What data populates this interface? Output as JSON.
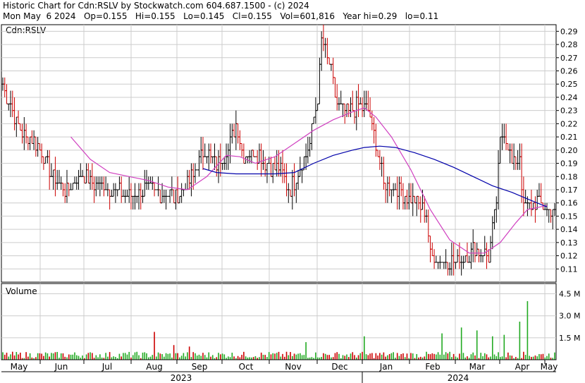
{
  "header": {
    "title": "Historic Chart for Cdn:RSLV by Stockwatch.com 604.687.1500 - (c) 2024",
    "stats": "Mon May  6 2024   Op=0.155   Hi=0.155   Lo=0.145   Cl=0.155   Vol=601,816   Year hi=0.29   lo=0.11"
  },
  "colors": {
    "up": "#000000",
    "down": "#cc0000",
    "ma_short": "#d040c0",
    "ma_long": "#0000aa",
    "vol_up": "#22aa22",
    "vol_down": "#cc0000",
    "grid": "#cccccc"
  },
  "chart_data": {
    "type": "ohlc",
    "symbol_label": "Cdn:RSLV",
    "y_ticks": [
      "0.29",
      "0.28",
      "0.27",
      "0.26",
      "0.25",
      "0.24",
      "0.23",
      "0.22",
      "0.21",
      "0.20",
      "0.19",
      "0.18",
      "0.17",
      "0.16",
      "0.15",
      "0.14",
      "0.13",
      "0.12",
      "0.11"
    ],
    "ylim": [
      0.1,
      0.295
    ],
    "x_months": [
      "May",
      "Jun",
      "Jul",
      "Aug",
      "Sep",
      "Oct",
      "Nov",
      "Dec",
      "Jan",
      "Feb",
      "Mar",
      "Apr",
      "May"
    ],
    "year_labels": [
      "2023",
      "2024"
    ],
    "volume_label": "Volume",
    "volume_ticks": [
      "4.5 M",
      "3.0 M",
      "1.5 M"
    ],
    "volume_ylim": [
      0,
      5.2
    ],
    "price_segments": [
      [
        0,
        0.25
      ],
      [
        6,
        0.225
      ],
      [
        12,
        0.21
      ],
      [
        18,
        0.205
      ],
      [
        24,
        0.185
      ],
      [
        32,
        0.17
      ],
      [
        40,
        0.18
      ],
      [
        48,
        0.175
      ],
      [
        56,
        0.172
      ],
      [
        64,
        0.165
      ],
      [
        72,
        0.17
      ],
      [
        80,
        0.168
      ],
      [
        88,
        0.165
      ],
      [
        96,
        0.175
      ],
      [
        104,
        0.2
      ],
      [
        110,
        0.19
      ],
      [
        116,
        0.2
      ],
      [
        120,
        0.22
      ],
      [
        124,
        0.195
      ],
      [
        130,
        0.2
      ],
      [
        136,
        0.19
      ],
      [
        142,
        0.185
      ],
      [
        148,
        0.17
      ],
      [
        154,
        0.19
      ],
      [
        158,
        0.205
      ],
      [
        162,
        0.24
      ],
      [
        164,
        0.285
      ],
      [
        168,
        0.265
      ],
      [
        172,
        0.235
      ],
      [
        178,
        0.23
      ],
      [
        184,
        0.235
      ],
      [
        188,
        0.23
      ],
      [
        192,
        0.205
      ],
      [
        196,
        0.175
      ],
      [
        202,
        0.17
      ],
      [
        208,
        0.165
      ],
      [
        214,
        0.16
      ],
      [
        218,
        0.15
      ],
      [
        220,
        0.12
      ],
      [
        226,
        0.115
      ],
      [
        232,
        0.115
      ],
      [
        238,
        0.12
      ],
      [
        244,
        0.125
      ],
      [
        250,
        0.12
      ],
      [
        254,
        0.16
      ],
      [
        256,
        0.205
      ],
      [
        258,
        0.215
      ],
      [
        262,
        0.19
      ],
      [
        266,
        0.195
      ],
      [
        268,
        0.155
      ],
      [
        272,
        0.16
      ],
      [
        276,
        0.16
      ],
      [
        280,
        0.155
      ]
    ],
    "ma_short_points": [
      [
        35,
        0.21
      ],
      [
        45,
        0.193
      ],
      [
        55,
        0.183
      ],
      [
        65,
        0.18
      ],
      [
        75,
        0.177
      ],
      [
        85,
        0.172
      ],
      [
        95,
        0.17
      ],
      [
        105,
        0.18
      ],
      [
        115,
        0.196
      ],
      [
        122,
        0.195
      ],
      [
        130,
        0.19
      ],
      [
        140,
        0.195
      ],
      [
        150,
        0.205
      ],
      [
        160,
        0.215
      ],
      [
        170,
        0.223
      ],
      [
        180,
        0.229
      ],
      [
        186,
        0.232
      ],
      [
        192,
        0.225
      ],
      [
        200,
        0.21
      ],
      [
        210,
        0.185
      ],
      [
        220,
        0.155
      ],
      [
        230,
        0.132
      ],
      [
        240,
        0.122
      ],
      [
        248,
        0.122
      ],
      [
        256,
        0.13
      ],
      [
        264,
        0.145
      ],
      [
        270,
        0.155
      ],
      [
        280,
        0.158
      ]
    ],
    "ma_long_points": [
      [
        103,
        0.186
      ],
      [
        110,
        0.183
      ],
      [
        120,
        0.182
      ],
      [
        130,
        0.182
      ],
      [
        140,
        0.182
      ],
      [
        150,
        0.183
      ],
      [
        160,
        0.19
      ],
      [
        170,
        0.196
      ],
      [
        180,
        0.2
      ],
      [
        186,
        0.202
      ],
      [
        194,
        0.203
      ],
      [
        202,
        0.202
      ],
      [
        212,
        0.198
      ],
      [
        222,
        0.193
      ],
      [
        232,
        0.187
      ],
      [
        242,
        0.18
      ],
      [
        252,
        0.173
      ],
      [
        262,
        0.168
      ],
      [
        270,
        0.163
      ],
      [
        280,
        0.157
      ]
    ],
    "volume_spikes": [
      [
        78,
        1.9
      ],
      [
        88,
        1.0
      ],
      [
        96,
        0.9
      ],
      [
        156,
        1.2
      ],
      [
        186,
        1.6
      ],
      [
        226,
        1.8
      ],
      [
        236,
        2.2
      ],
      [
        244,
        2.0
      ],
      [
        252,
        1.6
      ],
      [
        258,
        1.7
      ],
      [
        266,
        2.6
      ],
      [
        270,
        4.0
      ]
    ],
    "last_close": 0.155
  }
}
